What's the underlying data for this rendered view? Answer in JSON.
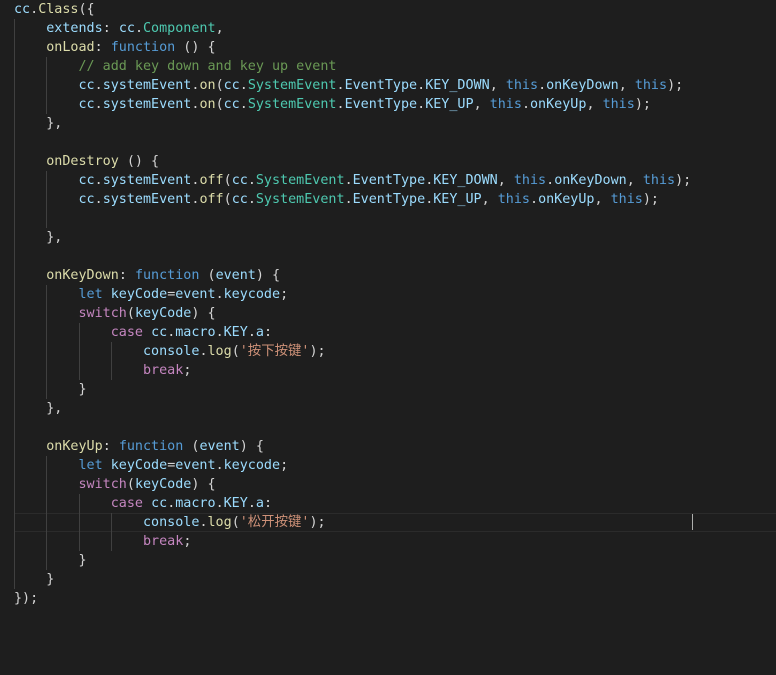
{
  "editor": {
    "colors": {
      "background": "#1e1e1e",
      "default": "#d4d4d4",
      "identifier": "#9cdcfe",
      "function": "#dcdcaa",
      "type": "#4ec9b0",
      "keyword": "#569cd6",
      "control": "#c586c0",
      "string": "#ce9178",
      "comment": "#6a9955"
    },
    "cursor": {
      "line": 27,
      "column": 40
    },
    "current_line": 27,
    "lines": [
      {
        "indent": 0,
        "tokens": [
          [
            "ident",
            "cc"
          ],
          [
            "default",
            "."
          ],
          [
            "func",
            "Class"
          ],
          [
            "default",
            "({"
          ]
        ]
      },
      {
        "indent": 1,
        "tokens": [
          [
            "prop",
            "extends"
          ],
          [
            "default",
            ": "
          ],
          [
            "ident",
            "cc"
          ],
          [
            "default",
            "."
          ],
          [
            "type",
            "Component"
          ],
          [
            "default",
            ","
          ]
        ]
      },
      {
        "indent": 1,
        "tokens": [
          [
            "func",
            "onLoad"
          ],
          [
            "default",
            ": "
          ],
          [
            "kw",
            "function"
          ],
          [
            "default",
            " () {"
          ]
        ]
      },
      {
        "indent": 2,
        "tokens": [
          [
            "comment",
            "// add key down and key up event"
          ]
        ]
      },
      {
        "indent": 2,
        "tokens": [
          [
            "ident",
            "cc"
          ],
          [
            "default",
            "."
          ],
          [
            "ident",
            "systemEvent"
          ],
          [
            "default",
            "."
          ],
          [
            "func",
            "on"
          ],
          [
            "default",
            "("
          ],
          [
            "ident",
            "cc"
          ],
          [
            "default",
            "."
          ],
          [
            "type",
            "SystemEvent"
          ],
          [
            "default",
            "."
          ],
          [
            "ident",
            "EventType"
          ],
          [
            "default",
            "."
          ],
          [
            "ident",
            "KEY_DOWN"
          ],
          [
            "default",
            ", "
          ],
          [
            "kw",
            "this"
          ],
          [
            "default",
            "."
          ],
          [
            "ident",
            "onKeyDown"
          ],
          [
            "default",
            ", "
          ],
          [
            "kw",
            "this"
          ],
          [
            "default",
            ");"
          ]
        ]
      },
      {
        "indent": 2,
        "tokens": [
          [
            "ident",
            "cc"
          ],
          [
            "default",
            "."
          ],
          [
            "ident",
            "systemEvent"
          ],
          [
            "default",
            "."
          ],
          [
            "func",
            "on"
          ],
          [
            "default",
            "("
          ],
          [
            "ident",
            "cc"
          ],
          [
            "default",
            "."
          ],
          [
            "type",
            "SystemEvent"
          ],
          [
            "default",
            "."
          ],
          [
            "ident",
            "EventType"
          ],
          [
            "default",
            "."
          ],
          [
            "ident",
            "KEY_UP"
          ],
          [
            "default",
            ", "
          ],
          [
            "kw",
            "this"
          ],
          [
            "default",
            "."
          ],
          [
            "ident",
            "onKeyUp"
          ],
          [
            "default",
            ", "
          ],
          [
            "kw",
            "this"
          ],
          [
            "default",
            ");"
          ]
        ]
      },
      {
        "indent": 1,
        "tokens": [
          [
            "default",
            "},"
          ]
        ]
      },
      {
        "indent": 1,
        "tokens": []
      },
      {
        "indent": 1,
        "tokens": [
          [
            "func",
            "onDestroy"
          ],
          [
            "default",
            " () {"
          ]
        ]
      },
      {
        "indent": 2,
        "tokens": [
          [
            "ident",
            "cc"
          ],
          [
            "default",
            "."
          ],
          [
            "ident",
            "systemEvent"
          ],
          [
            "default",
            "."
          ],
          [
            "func",
            "off"
          ],
          [
            "default",
            "("
          ],
          [
            "ident",
            "cc"
          ],
          [
            "default",
            "."
          ],
          [
            "type",
            "SystemEvent"
          ],
          [
            "default",
            "."
          ],
          [
            "ident",
            "EventType"
          ],
          [
            "default",
            "."
          ],
          [
            "ident",
            "KEY_DOWN"
          ],
          [
            "default",
            ", "
          ],
          [
            "kw",
            "this"
          ],
          [
            "default",
            "."
          ],
          [
            "ident",
            "onKeyDown"
          ],
          [
            "default",
            ", "
          ],
          [
            "kw",
            "this"
          ],
          [
            "default",
            ");"
          ]
        ]
      },
      {
        "indent": 2,
        "tokens": [
          [
            "ident",
            "cc"
          ],
          [
            "default",
            "."
          ],
          [
            "ident",
            "systemEvent"
          ],
          [
            "default",
            "."
          ],
          [
            "func",
            "off"
          ],
          [
            "default",
            "("
          ],
          [
            "ident",
            "cc"
          ],
          [
            "default",
            "."
          ],
          [
            "type",
            "SystemEvent"
          ],
          [
            "default",
            "."
          ],
          [
            "ident",
            "EventType"
          ],
          [
            "default",
            "."
          ],
          [
            "ident",
            "KEY_UP"
          ],
          [
            "default",
            ", "
          ],
          [
            "kw",
            "this"
          ],
          [
            "default",
            "."
          ],
          [
            "ident",
            "onKeyUp"
          ],
          [
            "default",
            ", "
          ],
          [
            "kw",
            "this"
          ],
          [
            "default",
            ");"
          ]
        ]
      },
      {
        "indent": 2,
        "tokens": []
      },
      {
        "indent": 1,
        "tokens": [
          [
            "default",
            "},"
          ]
        ]
      },
      {
        "indent": 1,
        "tokens": []
      },
      {
        "indent": 1,
        "tokens": [
          [
            "func",
            "onKeyDown"
          ],
          [
            "default",
            ": "
          ],
          [
            "kw",
            "function"
          ],
          [
            "default",
            " ("
          ],
          [
            "ident",
            "event"
          ],
          [
            "default",
            ") {"
          ]
        ]
      },
      {
        "indent": 2,
        "tokens": [
          [
            "kw",
            "let"
          ],
          [
            "default",
            " "
          ],
          [
            "ident",
            "keyCode"
          ],
          [
            "default",
            "="
          ],
          [
            "ident",
            "event"
          ],
          [
            "default",
            "."
          ],
          [
            "ident",
            "keycode"
          ],
          [
            "default",
            ";"
          ]
        ]
      },
      {
        "indent": 2,
        "tokens": [
          [
            "ctrl",
            "switch"
          ],
          [
            "default",
            "("
          ],
          [
            "ident",
            "keyCode"
          ],
          [
            "default",
            ") {"
          ]
        ]
      },
      {
        "indent": 3,
        "tokens": [
          [
            "ctrl",
            "case"
          ],
          [
            "default",
            " "
          ],
          [
            "ident",
            "cc"
          ],
          [
            "default",
            "."
          ],
          [
            "ident",
            "macro"
          ],
          [
            "default",
            "."
          ],
          [
            "ident",
            "KEY"
          ],
          [
            "default",
            "."
          ],
          [
            "ident",
            "a"
          ],
          [
            "default",
            ":"
          ]
        ]
      },
      {
        "indent": 4,
        "tokens": [
          [
            "ident",
            "console"
          ],
          [
            "default",
            "."
          ],
          [
            "func",
            "log"
          ],
          [
            "default",
            "("
          ],
          [
            "str",
            "'按下按键'"
          ],
          [
            "default",
            ");"
          ]
        ]
      },
      {
        "indent": 4,
        "tokens": [
          [
            "ctrl",
            "break"
          ],
          [
            "default",
            ";"
          ]
        ]
      },
      {
        "indent": 2,
        "tokens": [
          [
            "default",
            "}"
          ]
        ]
      },
      {
        "indent": 1,
        "tokens": [
          [
            "default",
            "},"
          ]
        ]
      },
      {
        "indent": 1,
        "tokens": []
      },
      {
        "indent": 1,
        "tokens": [
          [
            "func",
            "onKeyUp"
          ],
          [
            "default",
            ": "
          ],
          [
            "kw",
            "function"
          ],
          [
            "default",
            " ("
          ],
          [
            "ident",
            "event"
          ],
          [
            "default",
            ") {"
          ]
        ]
      },
      {
        "indent": 2,
        "tokens": [
          [
            "kw",
            "let"
          ],
          [
            "default",
            " "
          ],
          [
            "ident",
            "keyCode"
          ],
          [
            "default",
            "="
          ],
          [
            "ident",
            "event"
          ],
          [
            "default",
            "."
          ],
          [
            "ident",
            "keycode"
          ],
          [
            "default",
            ";"
          ]
        ]
      },
      {
        "indent": 2,
        "tokens": [
          [
            "ctrl",
            "switch"
          ],
          [
            "default",
            "("
          ],
          [
            "ident",
            "keyCode"
          ],
          [
            "default",
            ") {"
          ]
        ]
      },
      {
        "indent": 3,
        "tokens": [
          [
            "ctrl",
            "case"
          ],
          [
            "default",
            " "
          ],
          [
            "ident",
            "cc"
          ],
          [
            "default",
            "."
          ],
          [
            "ident",
            "macro"
          ],
          [
            "default",
            "."
          ],
          [
            "ident",
            "KEY"
          ],
          [
            "default",
            "."
          ],
          [
            "ident",
            "a"
          ],
          [
            "default",
            ":"
          ]
        ]
      },
      {
        "indent": 4,
        "tokens": [
          [
            "ident",
            "console"
          ],
          [
            "default",
            "."
          ],
          [
            "func",
            "log"
          ],
          [
            "default",
            "("
          ],
          [
            "str",
            "'松开按键'"
          ],
          [
            "default",
            ");"
          ]
        ]
      },
      {
        "indent": 4,
        "tokens": [
          [
            "ctrl",
            "break"
          ],
          [
            "default",
            ";"
          ]
        ]
      },
      {
        "indent": 2,
        "tokens": [
          [
            "default",
            "}"
          ]
        ]
      },
      {
        "indent": 1,
        "tokens": [
          [
            "default",
            "}"
          ]
        ]
      },
      {
        "indent": 0,
        "tokens": [
          [
            "default",
            "});"
          ]
        ]
      }
    ]
  }
}
